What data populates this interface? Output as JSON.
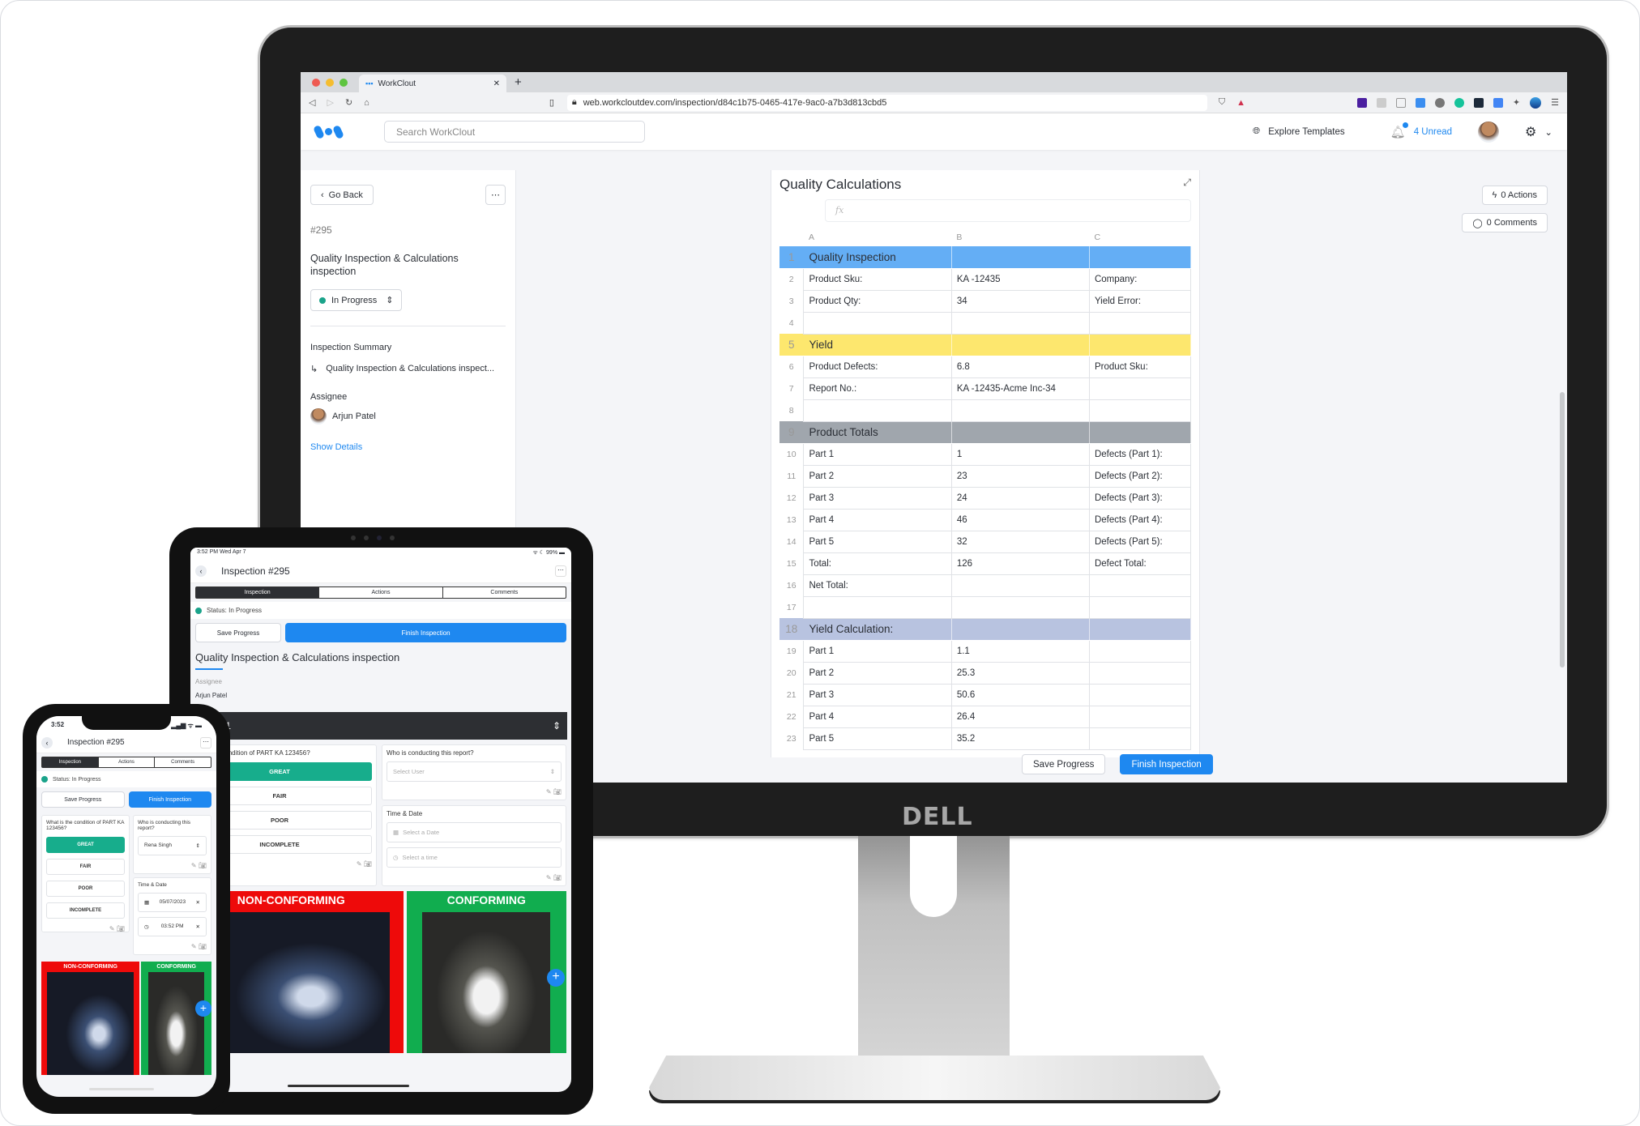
{
  "browser": {
    "tab_title": "WorkClout",
    "url": "web.workcloutdev.com/inspection/d84c1b75-0465-417e-9ac0-a7b3d813cbd5"
  },
  "app_header": {
    "search_placeholder": "Search WorkClout",
    "explore_templates": "Explore Templates",
    "unread": "4 Unread"
  },
  "sidebar": {
    "go_back": "Go Back",
    "number": "#295",
    "title": "Quality Inspection & Calculations inspection",
    "status": "In Progress",
    "summary_label": "Inspection Summary",
    "summary_item": "Quality Inspection & Calculations inspect...",
    "assignee_label": "Assignee",
    "assignee": "Arjun Patel",
    "show_details": "Show Details"
  },
  "sheet": {
    "title": "Quality Calculations",
    "fx": "fx",
    "columns": [
      "A",
      "B",
      "C"
    ],
    "rows": [
      {
        "n": "1",
        "a": "Quality Inspection",
        "b": "",
        "c": "",
        "style": "blue"
      },
      {
        "n": "2",
        "a": "Product Sku:",
        "b": "KA -12435",
        "c": "Company:"
      },
      {
        "n": "3",
        "a": "Product Qty:",
        "b": "34",
        "c": "Yield Error:"
      },
      {
        "n": "4",
        "a": "",
        "b": "",
        "c": ""
      },
      {
        "n": "5",
        "a": "Yield",
        "b": "",
        "c": "",
        "style": "yellow"
      },
      {
        "n": "6",
        "a": "Product Defects:",
        "b": "6.8",
        "c": "Product Sku:"
      },
      {
        "n": "7",
        "a": "Report No.:",
        "b": "KA -12435-Acme Inc-34",
        "c": ""
      },
      {
        "n": "8",
        "a": "",
        "b": "",
        "c": ""
      },
      {
        "n": "9",
        "a": "Product Totals",
        "b": "",
        "c": "",
        "style": "gray"
      },
      {
        "n": "10",
        "a": "Part 1",
        "b": "1",
        "c": "Defects (Part 1):"
      },
      {
        "n": "11",
        "a": "Part 2",
        "b": "23",
        "c": "Defects (Part 2):"
      },
      {
        "n": "12",
        "a": "Part 3",
        "b": "24",
        "c": "Defects (Part 3):"
      },
      {
        "n": "13",
        "a": "Part 4",
        "b": "46",
        "c": "Defects (Part 4):"
      },
      {
        "n": "14",
        "a": "Part 5",
        "b": "32",
        "c": "Defects (Part 5):"
      },
      {
        "n": "15",
        "a": "Total:",
        "b": "126",
        "c": "Defect Total:"
      },
      {
        "n": "16",
        "a": "Net Total:",
        "b": "",
        "c": ""
      },
      {
        "n": "17",
        "a": "",
        "b": "",
        "c": ""
      },
      {
        "n": "18",
        "a": "Yield Calculation:",
        "b": "",
        "c": "",
        "style": "lavender"
      },
      {
        "n": "19",
        "a": "Part 1",
        "b": "1.1",
        "c": ""
      },
      {
        "n": "20",
        "a": "Part 2",
        "b": "25.3",
        "c": ""
      },
      {
        "n": "21",
        "a": "Part 3",
        "b": "50.6",
        "c": ""
      },
      {
        "n": "22",
        "a": "Part 4",
        "b": "26.4",
        "c": ""
      },
      {
        "n": "23",
        "a": "Part 5",
        "b": "35.2",
        "c": ""
      }
    ]
  },
  "right_panel": {
    "actions": "0 Actions",
    "comments": "0 Comments"
  },
  "footer": {
    "save": "Save Progress",
    "finish": "Finish Inspection"
  },
  "monitor": {
    "brand": "DELL"
  },
  "colors": {
    "accent": "#1e88f0",
    "status_green": "#1aa38a",
    "blue_row": "#64aef5",
    "yellow_row": "#fde76e",
    "gray_row": "#a0a6ad",
    "lavender_row": "#b8c3e0"
  },
  "tablet": {
    "status_time": "3:52 PM  Wed Apr 7",
    "battery": "99%",
    "nav_title": "Inspection #295",
    "tabs": [
      "Inspection",
      "Actions",
      "Comments"
    ],
    "status": "Status: In Progress",
    "save": "Save Progress",
    "finish": "Finish Inspection",
    "title": "Quality Inspection & Calculations inspection",
    "assignee_label": "Assignee",
    "assignee": "Arjun Patel",
    "section": "Section 1",
    "q1": "What is the condition of PART KA 123456?",
    "options": [
      "GREAT",
      "FAIR",
      "POOR",
      "INCOMPLETE"
    ],
    "q2": "Who is conducting this report?",
    "select_user": "Select User",
    "time_date": "Time & Date",
    "date_placeholder": "Select a Date",
    "time_placeholder": "Select a time",
    "nonconforming": "NON-CONFORMING",
    "conforming": "CONFORMING"
  },
  "phone": {
    "status_time": "3:52",
    "nav_title": "Inspection #295",
    "tabs": [
      "Inspection",
      "Actions",
      "Comments"
    ],
    "status": "Status: In Progress",
    "save": "Save Progress",
    "finish": "Finish Inspection",
    "q1": "What is the condition of PART KA 123456?",
    "options": [
      "GREAT",
      "FAIR",
      "POOR",
      "INCOMPLETE"
    ],
    "q2": "Who is conducting this report?",
    "user": "Rena Singh",
    "time_date": "Time & Date",
    "date": "05/07/2023",
    "time": "03:52 PM",
    "nonconforming": "NON-CONFORMING",
    "conforming": "CONFORMING"
  }
}
